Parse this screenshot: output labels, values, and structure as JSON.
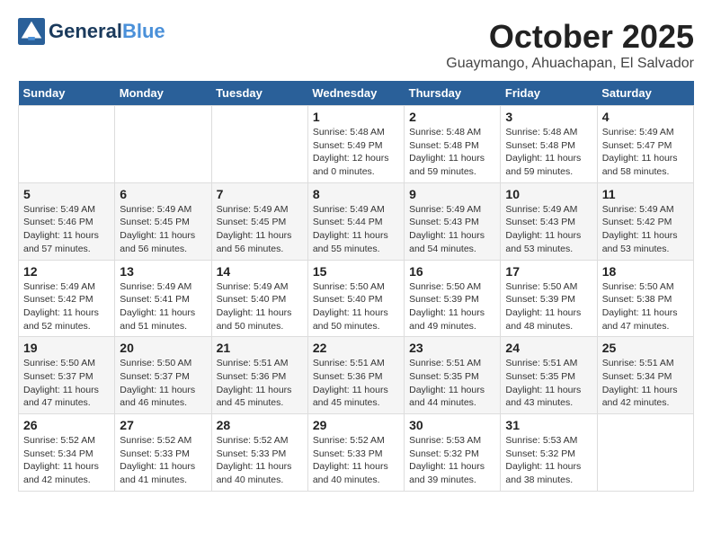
{
  "header": {
    "logo_line1": "General",
    "logo_line2": "Blue",
    "month": "October 2025",
    "location": "Guaymango, Ahuachapan, El Salvador"
  },
  "weekdays": [
    "Sunday",
    "Monday",
    "Tuesday",
    "Wednesday",
    "Thursday",
    "Friday",
    "Saturday"
  ],
  "weeks": [
    [
      {
        "day": "",
        "info": ""
      },
      {
        "day": "",
        "info": ""
      },
      {
        "day": "",
        "info": ""
      },
      {
        "day": "1",
        "info": "Sunrise: 5:48 AM\nSunset: 5:49 PM\nDaylight: 12 hours\nand 0 minutes."
      },
      {
        "day": "2",
        "info": "Sunrise: 5:48 AM\nSunset: 5:48 PM\nDaylight: 11 hours\nand 59 minutes."
      },
      {
        "day": "3",
        "info": "Sunrise: 5:48 AM\nSunset: 5:48 PM\nDaylight: 11 hours\nand 59 minutes."
      },
      {
        "day": "4",
        "info": "Sunrise: 5:49 AM\nSunset: 5:47 PM\nDaylight: 11 hours\nand 58 minutes."
      }
    ],
    [
      {
        "day": "5",
        "info": "Sunrise: 5:49 AM\nSunset: 5:46 PM\nDaylight: 11 hours\nand 57 minutes."
      },
      {
        "day": "6",
        "info": "Sunrise: 5:49 AM\nSunset: 5:45 PM\nDaylight: 11 hours\nand 56 minutes."
      },
      {
        "day": "7",
        "info": "Sunrise: 5:49 AM\nSunset: 5:45 PM\nDaylight: 11 hours\nand 56 minutes."
      },
      {
        "day": "8",
        "info": "Sunrise: 5:49 AM\nSunset: 5:44 PM\nDaylight: 11 hours\nand 55 minutes."
      },
      {
        "day": "9",
        "info": "Sunrise: 5:49 AM\nSunset: 5:43 PM\nDaylight: 11 hours\nand 54 minutes."
      },
      {
        "day": "10",
        "info": "Sunrise: 5:49 AM\nSunset: 5:43 PM\nDaylight: 11 hours\nand 53 minutes."
      },
      {
        "day": "11",
        "info": "Sunrise: 5:49 AM\nSunset: 5:42 PM\nDaylight: 11 hours\nand 53 minutes."
      }
    ],
    [
      {
        "day": "12",
        "info": "Sunrise: 5:49 AM\nSunset: 5:42 PM\nDaylight: 11 hours\nand 52 minutes."
      },
      {
        "day": "13",
        "info": "Sunrise: 5:49 AM\nSunset: 5:41 PM\nDaylight: 11 hours\nand 51 minutes."
      },
      {
        "day": "14",
        "info": "Sunrise: 5:49 AM\nSunset: 5:40 PM\nDaylight: 11 hours\nand 50 minutes."
      },
      {
        "day": "15",
        "info": "Sunrise: 5:50 AM\nSunset: 5:40 PM\nDaylight: 11 hours\nand 50 minutes."
      },
      {
        "day": "16",
        "info": "Sunrise: 5:50 AM\nSunset: 5:39 PM\nDaylight: 11 hours\nand 49 minutes."
      },
      {
        "day": "17",
        "info": "Sunrise: 5:50 AM\nSunset: 5:39 PM\nDaylight: 11 hours\nand 48 minutes."
      },
      {
        "day": "18",
        "info": "Sunrise: 5:50 AM\nSunset: 5:38 PM\nDaylight: 11 hours\nand 47 minutes."
      }
    ],
    [
      {
        "day": "19",
        "info": "Sunrise: 5:50 AM\nSunset: 5:37 PM\nDaylight: 11 hours\nand 47 minutes."
      },
      {
        "day": "20",
        "info": "Sunrise: 5:50 AM\nSunset: 5:37 PM\nDaylight: 11 hours\nand 46 minutes."
      },
      {
        "day": "21",
        "info": "Sunrise: 5:51 AM\nSunset: 5:36 PM\nDaylight: 11 hours\nand 45 minutes."
      },
      {
        "day": "22",
        "info": "Sunrise: 5:51 AM\nSunset: 5:36 PM\nDaylight: 11 hours\nand 45 minutes."
      },
      {
        "day": "23",
        "info": "Sunrise: 5:51 AM\nSunset: 5:35 PM\nDaylight: 11 hours\nand 44 minutes."
      },
      {
        "day": "24",
        "info": "Sunrise: 5:51 AM\nSunset: 5:35 PM\nDaylight: 11 hours\nand 43 minutes."
      },
      {
        "day": "25",
        "info": "Sunrise: 5:51 AM\nSunset: 5:34 PM\nDaylight: 11 hours\nand 42 minutes."
      }
    ],
    [
      {
        "day": "26",
        "info": "Sunrise: 5:52 AM\nSunset: 5:34 PM\nDaylight: 11 hours\nand 42 minutes."
      },
      {
        "day": "27",
        "info": "Sunrise: 5:52 AM\nSunset: 5:33 PM\nDaylight: 11 hours\nand 41 minutes."
      },
      {
        "day": "28",
        "info": "Sunrise: 5:52 AM\nSunset: 5:33 PM\nDaylight: 11 hours\nand 40 minutes."
      },
      {
        "day": "29",
        "info": "Sunrise: 5:52 AM\nSunset: 5:33 PM\nDaylight: 11 hours\nand 40 minutes."
      },
      {
        "day": "30",
        "info": "Sunrise: 5:53 AM\nSunset: 5:32 PM\nDaylight: 11 hours\nand 39 minutes."
      },
      {
        "day": "31",
        "info": "Sunrise: 5:53 AM\nSunset: 5:32 PM\nDaylight: 11 hours\nand 38 minutes."
      },
      {
        "day": "",
        "info": ""
      }
    ]
  ]
}
